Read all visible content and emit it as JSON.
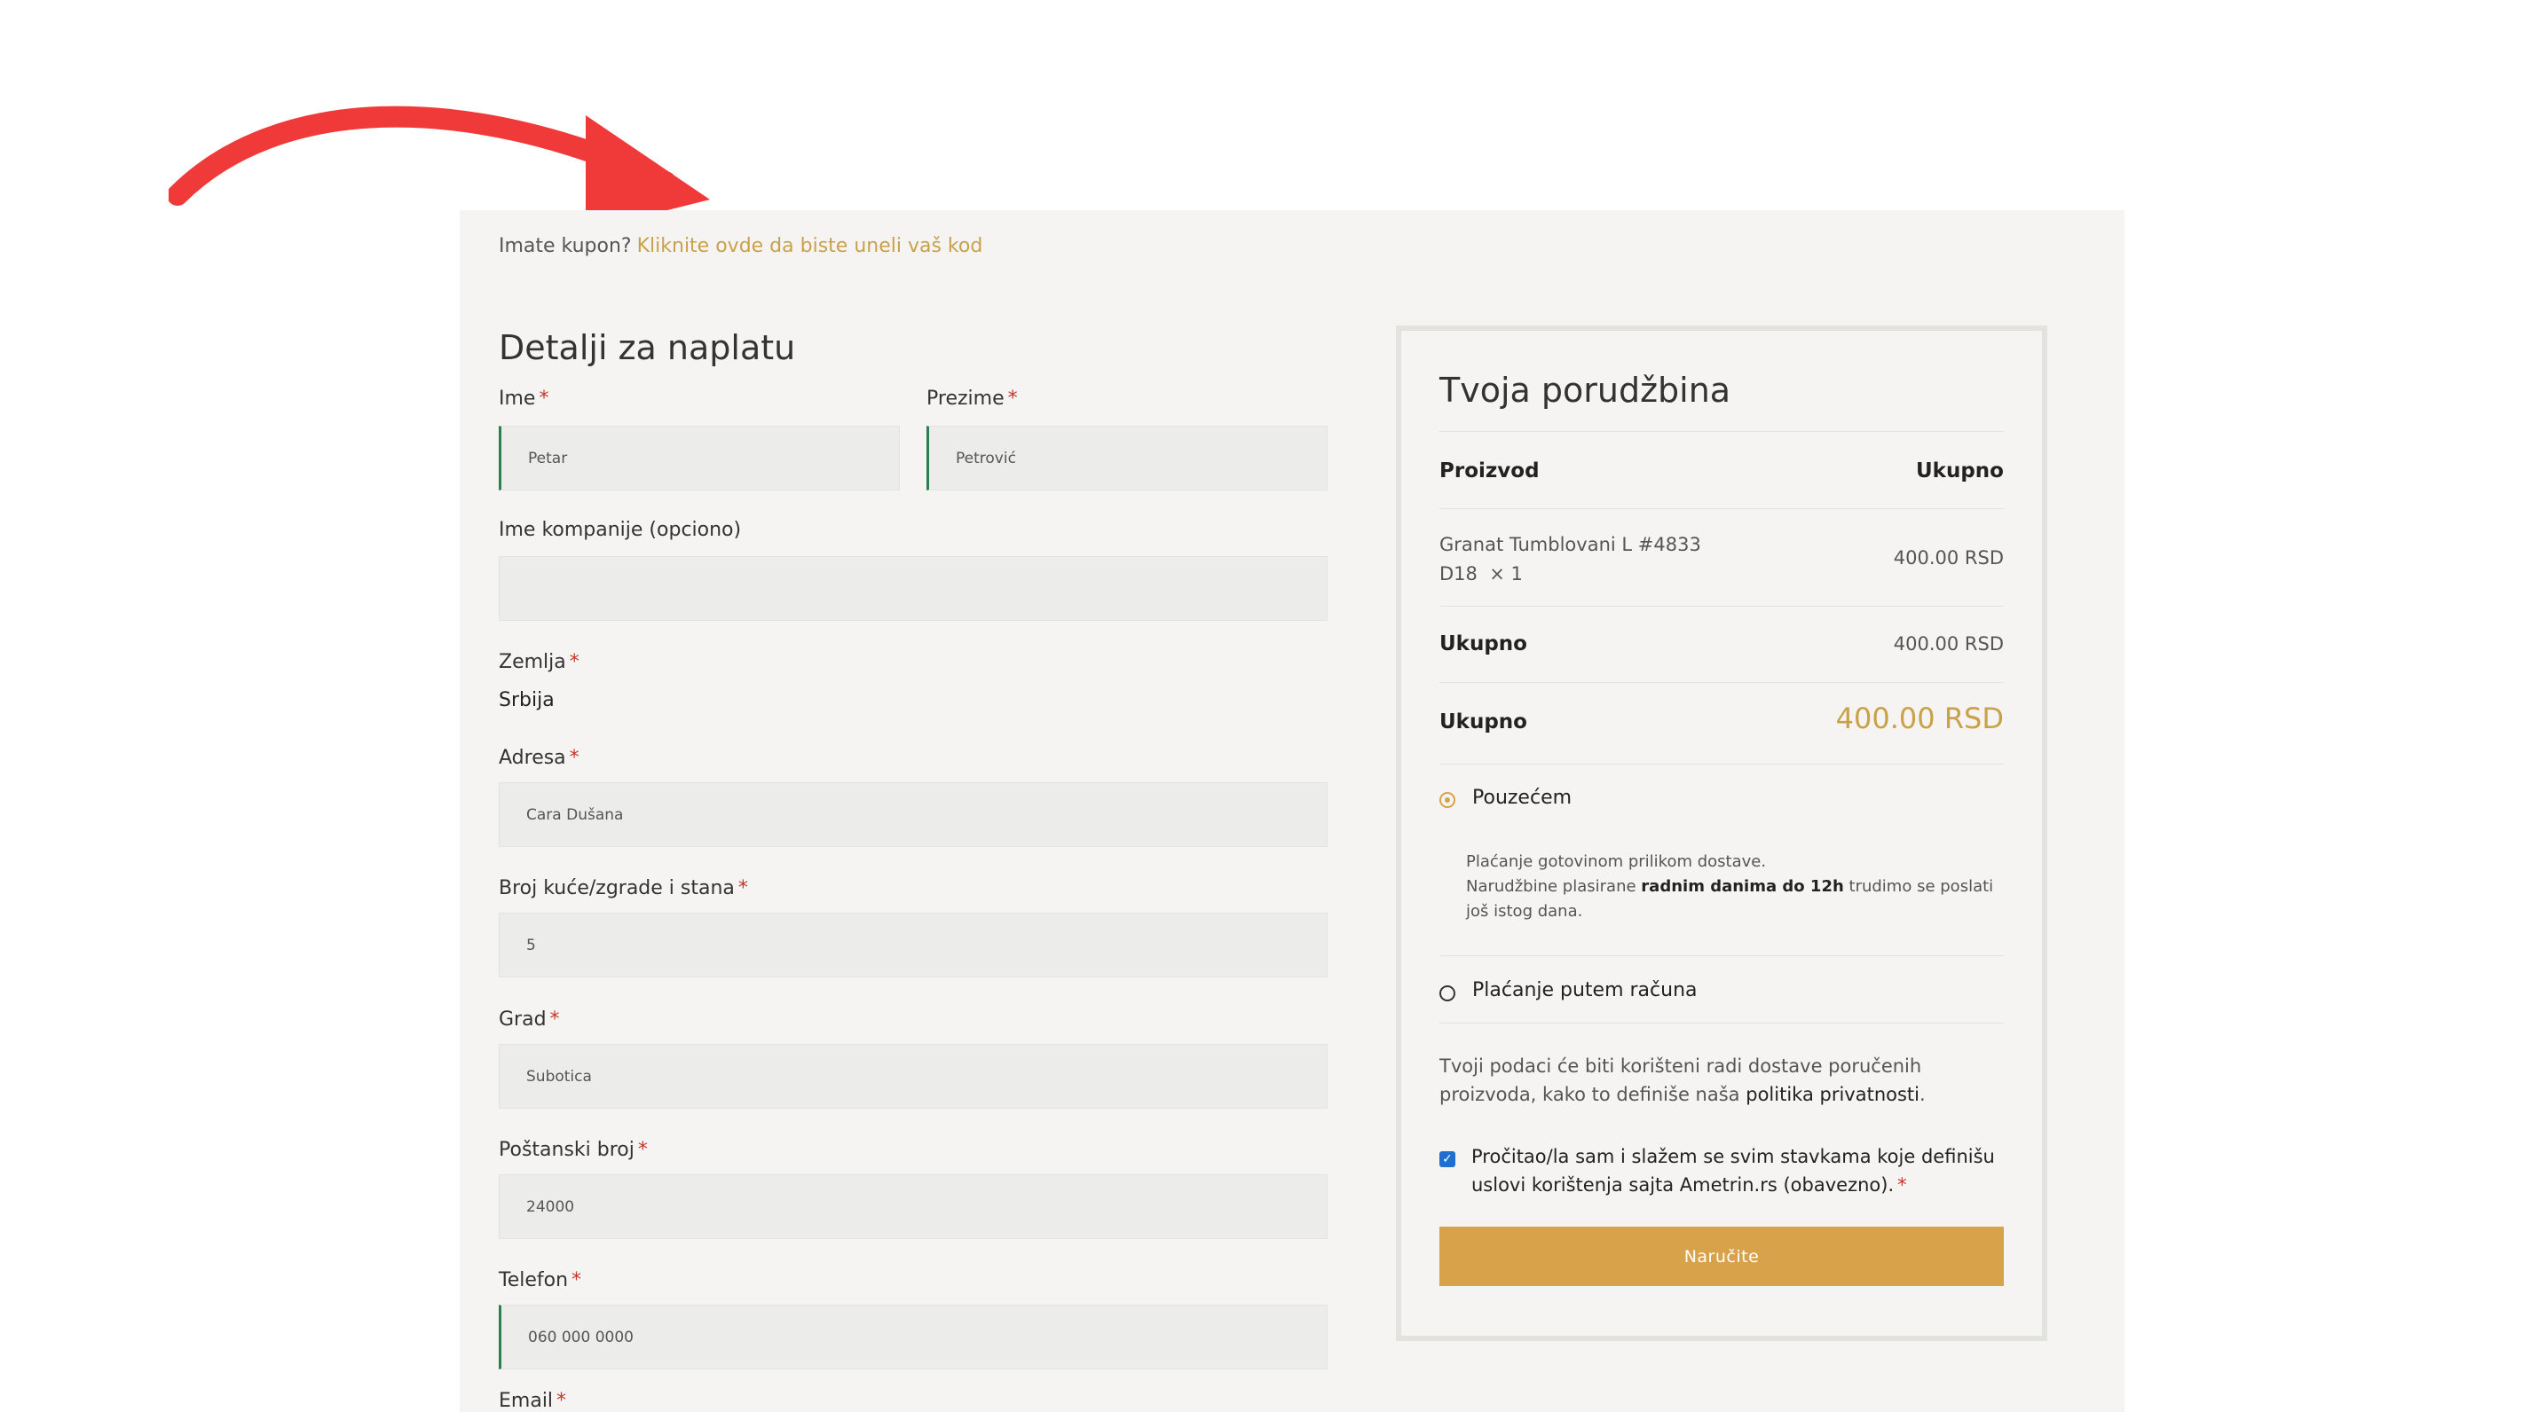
{
  "coupon": {
    "question": "Imate kupon?",
    "link": "Kliknite ovde da biste uneli vaš kod"
  },
  "billing": {
    "title": "Detalji za naplatu",
    "required_mark": "*",
    "first_name": {
      "label": "Ime",
      "value": "Petar"
    },
    "last_name": {
      "label": "Prezime",
      "value": "Petrović"
    },
    "company": {
      "label": "Ime kompanije (opciono)",
      "value": ""
    },
    "country": {
      "label": "Zemlja",
      "value": "Srbija"
    },
    "address": {
      "label": "Adresa",
      "value": "Cara Dušana"
    },
    "house": {
      "label": "Broj kuće/zgrade i stana",
      "value": "5"
    },
    "city": {
      "label": "Grad",
      "value": "Subotica"
    },
    "postal": {
      "label": "Poštanski broj",
      "value": "24000"
    },
    "phone": {
      "label": "Telefon",
      "value": "060 000 0000"
    },
    "email": {
      "label": "Email"
    }
  },
  "order": {
    "title": "Tvoja porudžbina",
    "col_product": "Proizvod",
    "col_total": "Ukupno",
    "item": {
      "name": "Granat Tumblovani L #4833",
      "variant": "D18",
      "qty": "× 1",
      "price": "400.00 RSD"
    },
    "subtotal": {
      "label": "Ukupno",
      "value": "400.00 RSD"
    },
    "total": {
      "label": "Ukupno",
      "value": "400.00 RSD"
    },
    "payment": {
      "cod_label": "Pouzećem",
      "cod_desc_line1": "Plaćanje gotovinom prilikom dostave.",
      "cod_desc_line2_a": "Narudžbine plasirane",
      "cod_desc_line2_b": "radnim danima do 12h",
      "cod_desc_line2_c": "trudimo se poslati",
      "cod_desc_line3": "još istog dana.",
      "invoice_label": "Plaćanje putem računa"
    },
    "privacy_a": "Tvoji podaci će biti korišteni radi dostave poručenih proizvoda, kako to definiše naša",
    "privacy_link": "politika privatnosti",
    "privacy_end": ".",
    "terms": "Pročitao/la sam i slažem se svim stavkama koje definišu uslovi korištenja sajta Ametrin.rs (obavezno).",
    "checkbox_mark": "✓",
    "button": "Naručite"
  },
  "colors": {
    "accent": "#d8a24a",
    "link": "#c9a14a",
    "arrow": "#f03a3a",
    "valid": "#2e7d4f"
  }
}
